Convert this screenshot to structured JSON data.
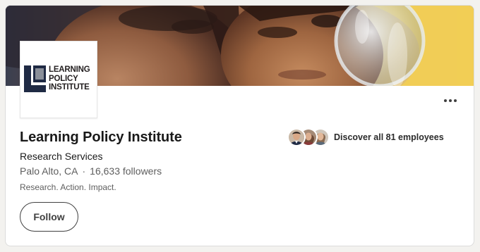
{
  "company": {
    "name": "Learning Policy Institute",
    "industry": "Research Services",
    "location": "Palo Alto, CA",
    "separator": "·",
    "followers": "16,633 followers",
    "tagline": "Research. Action. Impact."
  },
  "logo": {
    "line1": "LEARNING",
    "line2": "POLICY",
    "line3": "INSTITUTE"
  },
  "actions": {
    "follow_label": "Follow",
    "more_icon": "ellipsis-icon"
  },
  "employees": {
    "label": "Discover all 81 employees"
  },
  "icons": {
    "logo_mark": "lpi-logo-mark",
    "more": "more-horizontal-icon"
  },
  "colors": {
    "card_bg": "#ffffff",
    "page_bg": "#f3f2ef",
    "logo_navy": "#1f2a44",
    "logo_gray": "#8a8f99",
    "cover_yellow": "#f4d250"
  }
}
